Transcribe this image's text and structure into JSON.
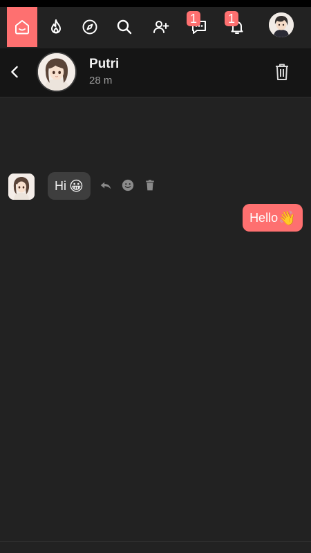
{
  "nav": {
    "items": [
      {
        "icon": "home-icon",
        "active": true
      },
      {
        "icon": "flame-icon"
      },
      {
        "icon": "compass-icon"
      },
      {
        "icon": "search-icon"
      },
      {
        "icon": "add-user-icon"
      },
      {
        "icon": "chat-icon",
        "badge": "1"
      },
      {
        "icon": "bell-icon",
        "badge": "1"
      }
    ],
    "accent": "#fe7070"
  },
  "header": {
    "name": "Putri",
    "status": "28 m"
  },
  "messages": [
    {
      "direction": "incoming",
      "text": "Hi",
      "emoji": "😀"
    },
    {
      "direction": "outgoing",
      "text": "Hello",
      "emoji": "👋"
    }
  ],
  "colors": {
    "background": "#222222",
    "header": "#151515",
    "bubble_incoming": "#3e3e3e",
    "bubble_outgoing": "#fe7070"
  }
}
